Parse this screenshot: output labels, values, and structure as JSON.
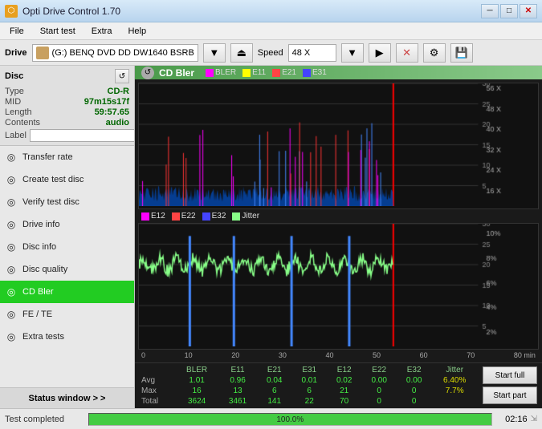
{
  "titlebar": {
    "title": "Opti Drive Control 1.70",
    "icon": "⬡",
    "minimize": "─",
    "restore": "□",
    "close": "✕"
  },
  "menubar": {
    "items": [
      "File",
      "Start test",
      "Extra",
      "Help"
    ]
  },
  "drivebar": {
    "drive_label": "Drive",
    "drive_value": "(G:)  BENQ DVD DD DW1640 BSRB",
    "speed_label": "Speed",
    "speed_value": "48 X"
  },
  "disc": {
    "header": "Disc",
    "type_label": "Type",
    "type_value": "CD-R",
    "mid_label": "MID",
    "mid_value": "97m15s17f",
    "length_label": "Length",
    "length_value": "59:57.65",
    "contents_label": "Contents",
    "contents_value": "audio",
    "label_label": "Label",
    "label_value": ""
  },
  "sidebar": {
    "items": [
      {
        "id": "transfer-rate",
        "label": "Transfer rate",
        "icon": "◎"
      },
      {
        "id": "create-test-disc",
        "label": "Create test disc",
        "icon": "◎"
      },
      {
        "id": "verify-test-disc",
        "label": "Verify test disc",
        "icon": "◎"
      },
      {
        "id": "drive-info",
        "label": "Drive info",
        "icon": "◎"
      },
      {
        "id": "disc-info",
        "label": "Disc info",
        "icon": "◎"
      },
      {
        "id": "disc-quality",
        "label": "Disc quality",
        "icon": "◎"
      },
      {
        "id": "cd-bler",
        "label": "CD Bler",
        "icon": "◎",
        "active": true
      },
      {
        "id": "fe-te",
        "label": "FE / TE",
        "icon": "◎"
      },
      {
        "id": "extra-tests",
        "label": "Extra tests",
        "icon": "◎"
      }
    ],
    "status_window": "Status window > >"
  },
  "chart": {
    "title": "CD Bler",
    "legend_top": [
      {
        "id": "bler",
        "label": "BLER",
        "color": "#ff00ff"
      },
      {
        "id": "e11",
        "label": "E11",
        "color": "#ffff00"
      },
      {
        "id": "e21",
        "label": "E21",
        "color": "#ff4444"
      },
      {
        "id": "e31",
        "label": "E31",
        "color": "#4444ff"
      }
    ],
    "legend_bottom": [
      {
        "id": "e12",
        "label": "E12",
        "color": "#ff00ff"
      },
      {
        "id": "e22",
        "label": "E22",
        "color": "#ff4444"
      },
      {
        "id": "e32",
        "label": "E32",
        "color": "#4444ff"
      },
      {
        "id": "jitter",
        "label": "Jitter",
        "color": "#88ff88"
      }
    ]
  },
  "stats": {
    "headers": [
      "BLER",
      "E11",
      "E21",
      "E31",
      "E12",
      "E22",
      "E32",
      "Jitter"
    ],
    "rows": [
      {
        "label": "Avg",
        "values": [
          "1.01",
          "0.96",
          "0.04",
          "0.01",
          "0.02",
          "0.00",
          "0.00",
          "6.40%"
        ]
      },
      {
        "label": "Max",
        "values": [
          "16",
          "13",
          "6",
          "6",
          "21",
          "0",
          "0",
          "7.7%"
        ]
      },
      {
        "label": "Total",
        "values": [
          "3624",
          "3461",
          "141",
          "22",
          "70",
          "0",
          "0",
          ""
        ]
      }
    ],
    "start_full": "Start full",
    "start_part": "Start part"
  },
  "statusbar": {
    "text": "Test completed",
    "progress": 100,
    "progress_label": "100.0%",
    "time": "02:16"
  }
}
